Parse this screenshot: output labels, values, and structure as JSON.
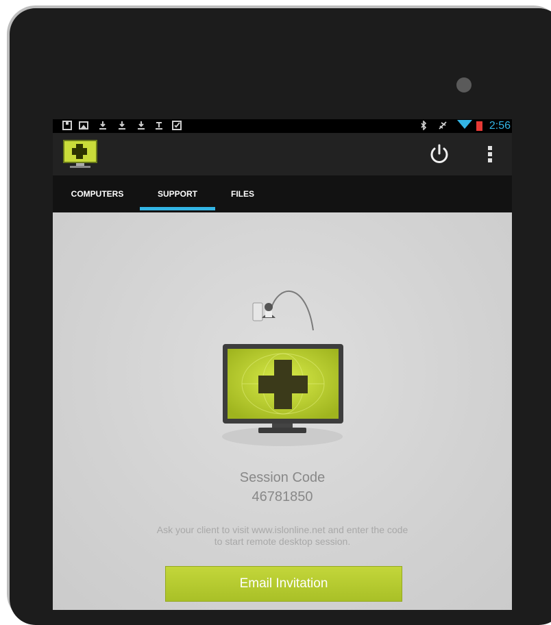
{
  "status_bar": {
    "time": "2:56",
    "left_icons": [
      "sd-card-icon",
      "image-icon",
      "download-icon",
      "download-icon",
      "download-icon",
      "upload-icon",
      "checkbox-icon"
    ],
    "right_icons": [
      "bluetooth-icon",
      "airplane-icon",
      "wifi-icon",
      "battery-icon"
    ],
    "time_color": "#33b5e5"
  },
  "action_bar": {
    "logo": "isl-plus-monitor-icon",
    "actions": [
      "power-icon",
      "overflow-menu-icon"
    ]
  },
  "tabs": [
    {
      "label": "COMPUTERS",
      "selected": false
    },
    {
      "label": "SUPPORT",
      "selected": true
    },
    {
      "label": "FILES",
      "selected": false
    }
  ],
  "support": {
    "session_label": "Session Code",
    "session_code": "46781850",
    "instructions": "Ask your client to visit www.islonline.net and enter the code to start remote desktop session.",
    "email_button_label": "Email Invitation"
  },
  "colors": {
    "accent": "#33b5e5",
    "brand_green": "#b4ca2e",
    "action_bar": "#222222"
  }
}
